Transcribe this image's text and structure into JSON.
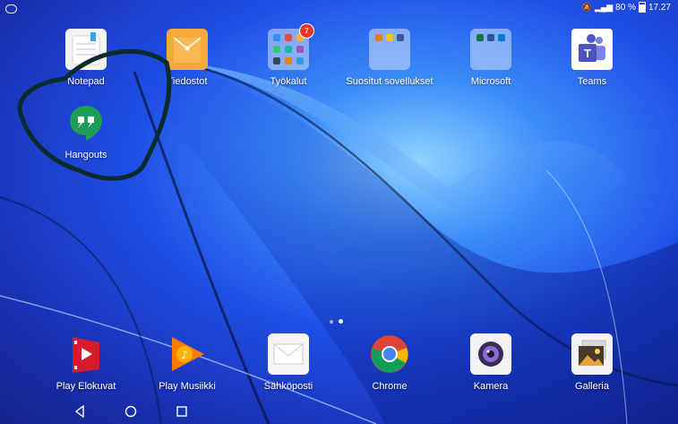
{
  "status_bar": {
    "battery": "80 %",
    "time": "17.27"
  },
  "home_apps": [
    {
      "label": "Notepad"
    },
    {
      "label": "Tiedostot"
    },
    {
      "label": "Työkalut",
      "badge": "7"
    },
    {
      "label": "Suositut sovellukset"
    },
    {
      "label": "Microsoft"
    },
    {
      "label": "Teams"
    },
    {
      "label": "Hangouts"
    }
  ],
  "dock_apps": [
    {
      "label": "Play Elokuvat"
    },
    {
      "label": "Play Musiikki"
    },
    {
      "label": "Sähköposti"
    },
    {
      "label": "Chrome"
    },
    {
      "label": "Kamera"
    },
    {
      "label": "Galleria"
    }
  ],
  "page_indicator": {
    "pages": 2,
    "current": 2
  },
  "colors": {
    "accent_badge": "#e8352b",
    "annotation": "#0b2b2f",
    "hangouts_green": "#1e9e55",
    "tiedostot_orange": "#f6a93b"
  }
}
